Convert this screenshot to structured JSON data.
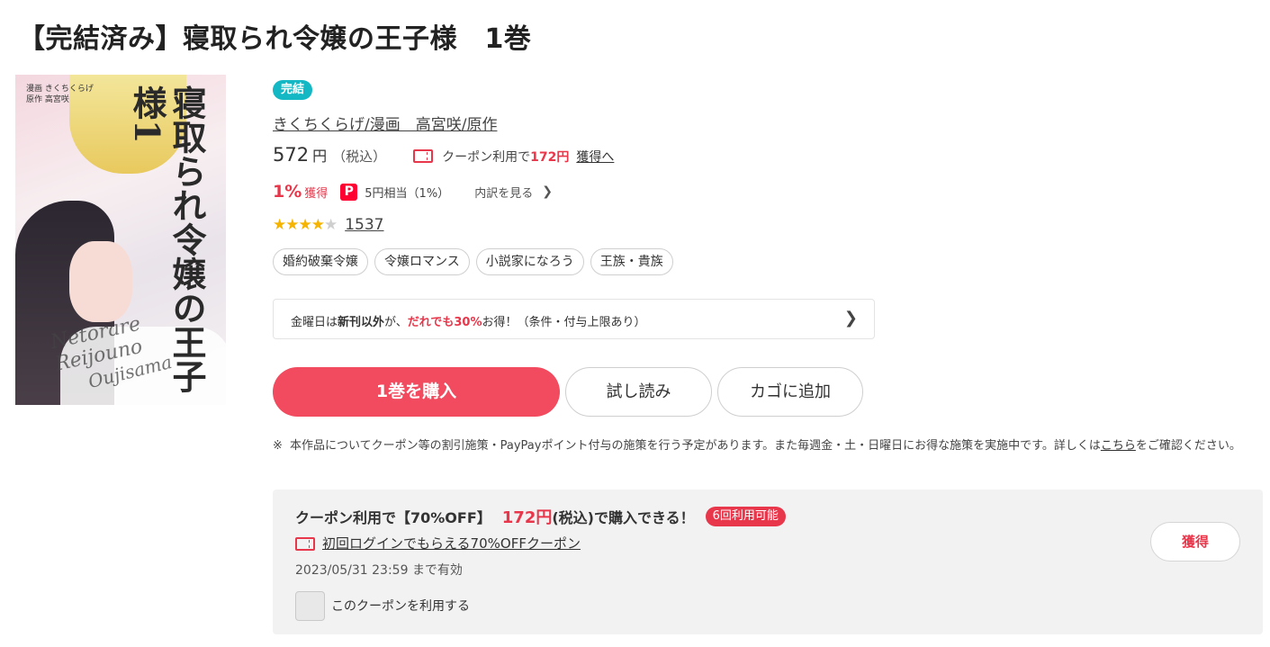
{
  "page": {
    "title": "【完結済み】寝取られ令嬢の王子様　1巻"
  },
  "cover": {
    "title_vertical": "寝取られ令嬢の王子様",
    "volume": "1",
    "author_line1": "漫画 きくちくらげ",
    "author_line2": "原作 高宮咲",
    "script_line1": "Netorare Reijouno",
    "script_line2": "Oujisama"
  },
  "product": {
    "status_badge": "完結",
    "authors": "きくちくらげ/漫画　高宮咲/原作",
    "price": "572",
    "price_unit": "円",
    "tax_note": "（税込）",
    "coupon_prefix": "クーポン利用で",
    "coupon_price": "172円",
    "coupon_link": "獲得へ",
    "point_percent": "1%",
    "point_get": "獲得",
    "paypay_icon": "paypay-icon",
    "point_yen": "5円相当（1%）",
    "point_detail": "内訳を見る",
    "rating_value": 4.5,
    "rating_stars_full": "★★★★",
    "rating_star_half": "★",
    "rating_count": "1537"
  },
  "tags": [
    "婚約破棄令嬢",
    "令嬢ロマンス",
    "小説家になろう",
    "王族・貴族"
  ],
  "campaign": {
    "part1": "金曜日は",
    "part2": "新刊以外",
    "part3": "が、",
    "part4": "だれでも30%",
    "part5": "お得！（条件・付与上限あり）"
  },
  "buttons": {
    "buy": "1巻を購入",
    "trial": "試し読み",
    "cart": "カゴに追加"
  },
  "notice": {
    "mark": "※",
    "text": "本作品についてクーポン等の割引施策・PayPayポイント付与の施策を行う予定があります。また毎週金・土・日曜日にお得な施策を実施中です。詳しくは",
    "link": "こちら",
    "tail": "をご確認ください。"
  },
  "coupon_box": {
    "head": "クーポン利用で【70%OFF】",
    "price": "172円",
    "tail": "(税込)で購入できる！",
    "times_badge": "6回利用可能",
    "name": "初回ログインでもらえる70%OFFクーポン",
    "expire": "2023/05/31 23:59 まで有効",
    "check_label": "このクーポンを利用する",
    "get_button": "獲得"
  },
  "colors": {
    "accent_red": "#e8374b",
    "buy_button": "#f24a5e",
    "badge_teal": "#14b8c4",
    "star": "#f5b400"
  }
}
